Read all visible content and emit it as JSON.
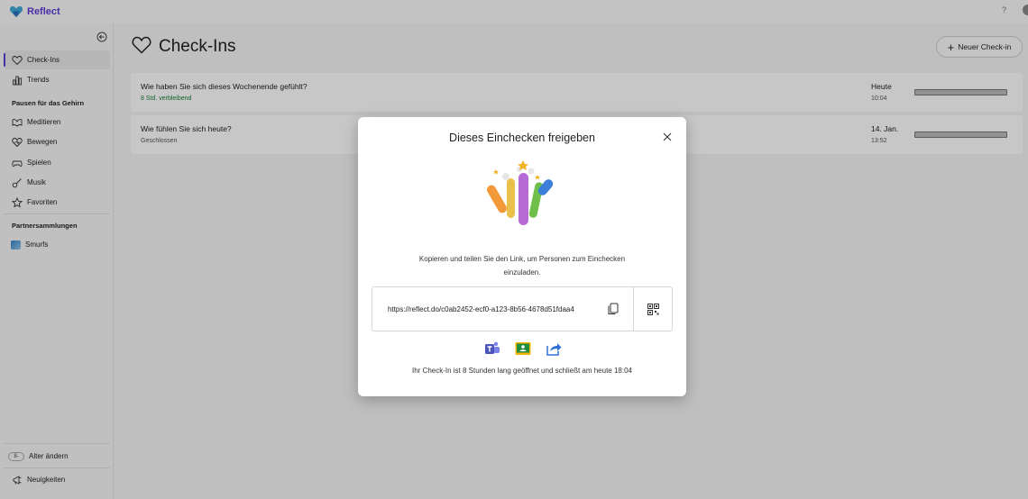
{
  "app": {
    "name": "Reflect",
    "help": "?"
  },
  "sidebar": {
    "items": [
      {
        "label": "Check-Ins",
        "icon": "heart-icon",
        "active": true
      },
      {
        "label": "Trends",
        "icon": "chart-icon"
      }
    ],
    "section_breaks": "Pausen für das Gehirn",
    "break_items": [
      {
        "label": "Meditieren",
        "icon": "meditate-icon"
      },
      {
        "label": "Bewegen",
        "icon": "move-icon"
      },
      {
        "label": "Spielen",
        "icon": "game-icon"
      },
      {
        "label": "Musik",
        "icon": "music-icon"
      },
      {
        "label": "Favoriten",
        "icon": "star-icon"
      }
    ],
    "section_partners": "Partnersammlungen",
    "partner_items": [
      {
        "label": "Smurfs",
        "icon": "smurfs-thumbnail"
      }
    ],
    "age_badge": "8-",
    "age_label": "Alter ändern",
    "news_label": "Neuigkeiten"
  },
  "main": {
    "title": "Check-Ins",
    "new_button": "Neuer Check-in",
    "cards": [
      {
        "question": "Wie haben Sie sich dieses Wochenende gefühlt?",
        "status": "8 Std. verbleibend",
        "day": "Heute",
        "time": "10:04"
      },
      {
        "question": "Wie fühlen Sie sich heute?",
        "status": "Geschlossen",
        "day": "14. Jan.",
        "time": "13:52"
      }
    ]
  },
  "dialog": {
    "title": "Dieses Einchecken freigeben",
    "text": "Kopieren und teilen Sie den Link, um Personen zum Einchecken einzuladen.",
    "link": "https://reflect.do/c0ab2452-ecf0-a123-8b56-4678d51fdaa4",
    "share_targets": [
      "teams-icon",
      "google-classroom-icon",
      "share-icon"
    ],
    "footer": "Ihr Check-In ist 8 Stunden lang geöffnet und schließt am heute 18:04"
  },
  "colors": {
    "accent": "#5b3bd6",
    "status_open": "#1a7f37",
    "overlay": "rgba(0,0,0,0.22)"
  }
}
